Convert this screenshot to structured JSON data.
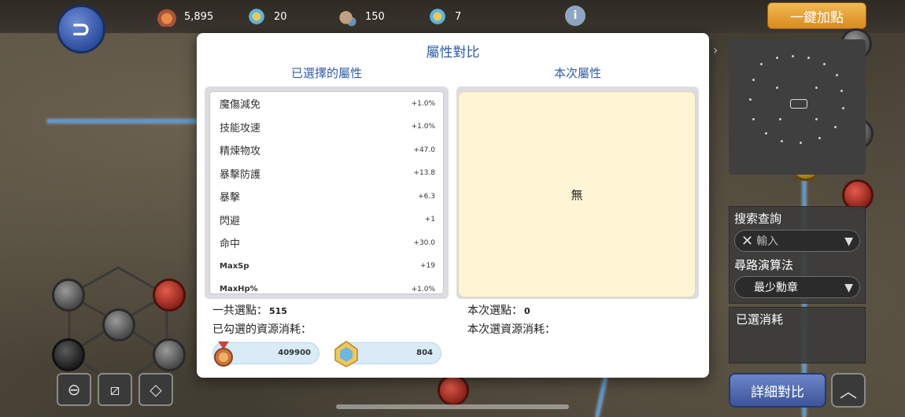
{
  "topbar": {
    "resources": [
      {
        "icon": "medal-icon",
        "value": "5,895"
      },
      {
        "icon": "gem-icon",
        "value": "20"
      },
      {
        "icon": "locked-medal-icon",
        "value": "150"
      },
      {
        "icon": "locked-gem-icon",
        "value": "7"
      }
    ],
    "info_glyph": "i",
    "onekey_label": "一鍵加點"
  },
  "modal": {
    "title": "屬性對比",
    "left_header": "已選擇的屬性",
    "right_header": "本次屬性",
    "attributes": [
      {
        "name": "魔傷減免",
        "value": "+1.0%"
      },
      {
        "name": "技能攻速",
        "value": "+1.0%"
      },
      {
        "name": "精煉物攻",
        "value": "+47.0"
      },
      {
        "name": "暴擊防護",
        "value": "+13.8"
      },
      {
        "name": "暴擊",
        "value": "+6.3"
      },
      {
        "name": "閃避",
        "value": "+1"
      },
      {
        "name": "命中",
        "value": "+30.0"
      },
      {
        "name": "MaxSp",
        "value": "+19"
      },
      {
        "name": "MaxHp%",
        "value": "+1.0%"
      }
    ],
    "right_empty": "無",
    "total_points_label": "一共選點：",
    "total_points": "515",
    "checked_cost_label": "已勾選的資源消耗：",
    "this_points_label": "本次選點：",
    "this_points": "0",
    "this_cost_label": "本次選資源消耗：",
    "costs": [
      {
        "icon": "medal-icon",
        "amount": "409900"
      },
      {
        "icon": "gem-icon",
        "amount": "804"
      }
    ]
  },
  "side": {
    "search_label": "搜索查詢",
    "search_placeholder": "輸入",
    "path_label": "尋路演算法",
    "path_value": "最少勳章",
    "cost_label": "已選消耗",
    "detail_label": "詳細對比"
  },
  "colors": {
    "accent_blue": "#2e5ea5",
    "onekey_orange": "#e9a03a",
    "detail_blue": "#4f6bb0",
    "panel_cream": "#fdf5d3"
  }
}
